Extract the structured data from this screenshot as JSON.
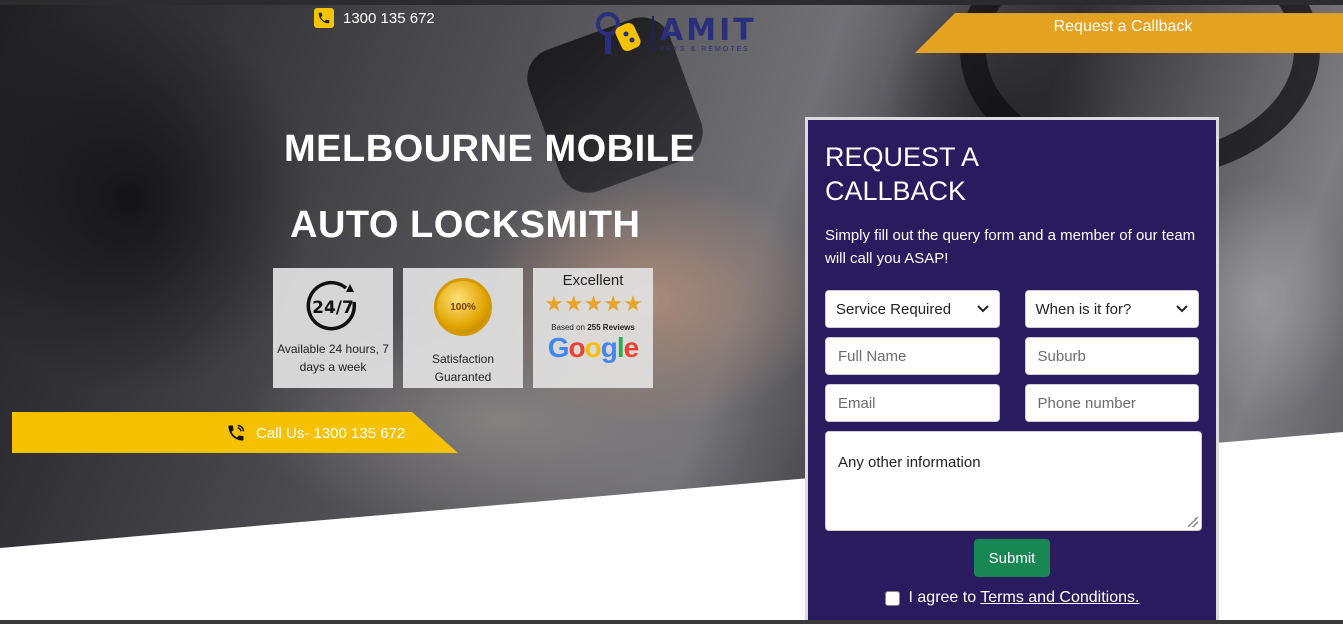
{
  "header": {
    "phone": "1300 135 672",
    "logo_text": "AMIT",
    "logo_subtext": "KEYS & REMOTES",
    "callback_button": "Request a Callback"
  },
  "hero": {
    "title_line1": "MELBOURNE MOBILE",
    "title_line2": "AUTO LOCKSMITH",
    "badges": {
      "availability": {
        "icon_text": "24/7",
        "caption": "Available 24 hours, 7 days a week"
      },
      "satisfaction": {
        "seal_text": "100%",
        "caption": "Satisfaction Guaranted"
      },
      "reviews": {
        "rating_word": "Excellent",
        "stars": 5,
        "based_on_prefix": "Based on ",
        "review_count": "255 Reviews",
        "provider": "Google"
      }
    },
    "call_button": "Call Us- 1300 135 672"
  },
  "form": {
    "title": "REQUEST A CALLBACK",
    "description": "Simply fill out the query form and a member of our team will call you ASAP!",
    "service_select": "Service Required",
    "when_select": "When is it for?",
    "full_name_placeholder": "Full Name",
    "suburb_placeholder": "Suburb",
    "email_placeholder": "Email",
    "phone_placeholder": "Phone number",
    "other_info_placeholder": "Any other information",
    "submit_label": "Submit",
    "agree_prefix": "I agree to ",
    "agree_link": "Terms and Conditions."
  },
  "colors": {
    "form_bg": "#291b5e",
    "callback_orange": "#e5a220",
    "call_yellow": "#f6c100",
    "submit_green": "#198754"
  }
}
